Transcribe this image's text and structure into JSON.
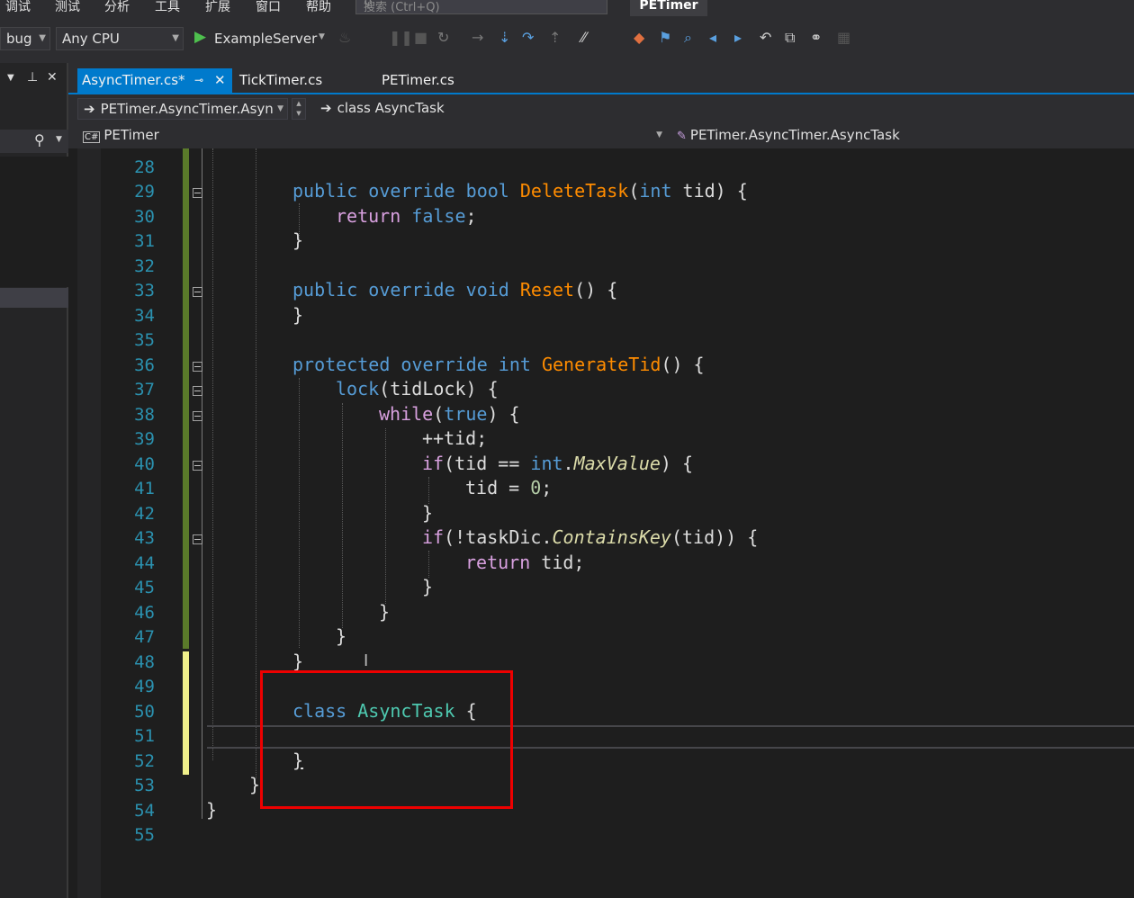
{
  "menu": [
    "调试",
    "测试",
    "分析",
    "工具",
    "扩展",
    "窗口",
    "帮助"
  ],
  "search": {
    "placeholder": "搜索 (Ctrl+Q)"
  },
  "app_title": "PETimer",
  "toolbar": {
    "config": "bug",
    "platform": "Any CPU",
    "startup": "ExampleServer"
  },
  "tabs": [
    {
      "label": "AsyncTimer.cs*",
      "active": true
    },
    {
      "label": "TickTimer.cs",
      "active": false
    },
    {
      "label": "PETimer.cs",
      "active": false
    }
  ],
  "navbar": {
    "type_combo": "PETimer.AsyncTimer.Asyn",
    "member_combo": "class AsyncTask",
    "project_combo": "PETimer",
    "scope_combo": "PETimer.AsyncTimer.AsyncTask"
  },
  "colors": {
    "accent": "#007acc",
    "highlight_box": "#ee0000",
    "line_numbers": "#2b91af"
  },
  "editor": {
    "line_numbers": [
      "28",
      "29",
      "30",
      "31",
      "32",
      "33",
      "34",
      "35",
      "36",
      "37",
      "38",
      "39",
      "40",
      "41",
      "42",
      "43",
      "44",
      "45",
      "46",
      "47",
      "48",
      "49",
      "50",
      "51",
      "52",
      "53",
      "54",
      "55"
    ],
    "code": {
      "l29_kw1": "public",
      "l29_kw2": "override",
      "l29_kw3": "bool",
      "l29_meth": "DeleteTask",
      "l29_p1": "(",
      "l29_kw4": "int",
      "l29_rest": " tid) {",
      "l30_kw1": "return",
      "l30_kw2": "false",
      "l30_rest": ";",
      "l31": "}",
      "l33_kw1": "public",
      "l33_kw2": "override",
      "l33_kw3": "void",
      "l33_meth": "Reset",
      "l33_rest": "() {",
      "l34": "}",
      "l36_kw1": "protected",
      "l36_kw2": "override",
      "l36_kw3": "int",
      "l36_meth": "GenerateTid",
      "l36_rest": "() {",
      "l37_kw": "lock",
      "l37_rest": "(tidLock) {",
      "l38_kw": "while",
      "l38_p": "(",
      "l38_kw2": "true",
      "l38_rest": ") {",
      "l39": "++tid;",
      "l40_kw": "if",
      "l40_a": "(tid == ",
      "l40_kw2": "int",
      "l40_dot": ".",
      "l40_prop": "MaxValue",
      "l40_rest": ") {",
      "l41_a": "tid = ",
      "l41_num": "0",
      "l41_rest": ";",
      "l42": "}",
      "l43_kw": "if",
      "l43_a": "(!taskDic.",
      "l43_ext": "ContainsKey",
      "l43_rest": "(tid)) {",
      "l44_kw": "return",
      "l44_rest": " tid;",
      "l45": "}",
      "l46": "}",
      "l47": "}",
      "l48": "}",
      "l50_kw": "class",
      "l50_type": "AsyncTask",
      "l50_rest": " {",
      "l52": "}",
      "l53": "}",
      "l54": "}"
    }
  }
}
